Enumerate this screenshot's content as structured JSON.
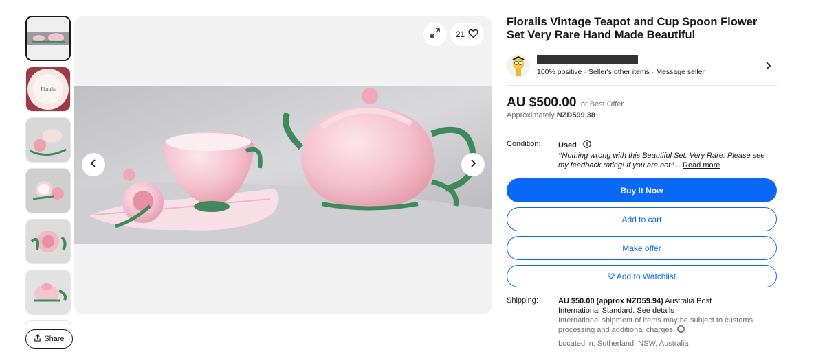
{
  "listing": {
    "title": "Floralis Vintage Teapot and Cup Spoon Flower Set Very Rare Hand Made Beautiful",
    "watch_count": "21",
    "share_label": "Share"
  },
  "seller": {
    "positive": "100% positive",
    "other_items": "Seller's other items",
    "message": "Message seller"
  },
  "price": {
    "main": "AU $500.00",
    "best_offer": "or Best Offer",
    "approx_label": "Approximately",
    "approx_value": "NZD599.38"
  },
  "condition": {
    "label": "Condition:",
    "value": "Used",
    "quote": "Nothing wrong with this Beautiful Set. Very Rare. Please see my feedback rating! If you are not",
    "read_more": "Read more"
  },
  "actions": {
    "buy_now": "Buy It Now",
    "add_to_cart": "Add to cart",
    "make_offer": "Make offer",
    "watchlist": "Add to Watchlist"
  },
  "shipping": {
    "label": "Shipping:",
    "cost": "AU $50.00 (approx NZD59.94)",
    "service": "Australia Post International Standard.",
    "see_details": "See details",
    "note": "International shipment of items may be subject to customs processing and additional charges.",
    "location": "Located in: Sutherland, NSW, Australia"
  },
  "colors": {
    "accent": "#0968f6",
    "pink": "#f2c4cf",
    "green": "#3f8a5c"
  },
  "icons": [
    "expand-icon",
    "heart-icon",
    "chevron-left-icon",
    "chevron-right-icon",
    "info-icon",
    "share-icon",
    "seller-avatar-icon"
  ]
}
